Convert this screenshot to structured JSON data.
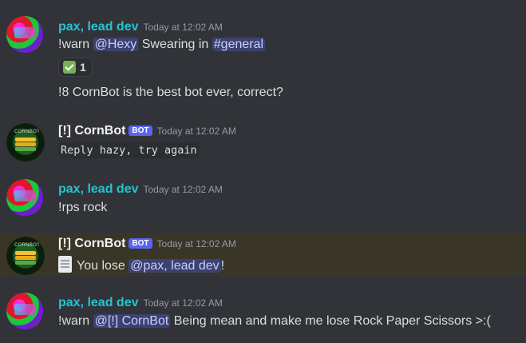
{
  "messages": [
    {
      "author": "pax, lead dev",
      "timestamp": "Today at 12:02 AM",
      "lines": {
        "warn_prefix": "!warn ",
        "mention": "@Hexy",
        "middle": " Swearing in ",
        "channel": "#general"
      },
      "reaction": {
        "emoji": "check-mark-emoji",
        "count": "1"
      },
      "followup": "!8 CornBot is the best bot ever, correct?"
    },
    {
      "author": "[!] CornBot",
      "bot_tag": "BOT",
      "timestamp": "Today at 12:02 AM",
      "code": "Reply hazy, try again",
      "avatar_text": "CORNBOT"
    },
    {
      "author": "pax, lead dev",
      "timestamp": "Today at 12:02 AM",
      "text": "!rps rock"
    },
    {
      "author": "[!] CornBot",
      "bot_tag": "BOT",
      "timestamp": "Today at 12:02 AM",
      "prefix": "You lose ",
      "mention": "@pax, lead dev",
      "suffix": "!",
      "icon": "page-icon",
      "avatar_text": "CORNBOT"
    },
    {
      "author": "pax, lead dev",
      "timestamp": "Today at 12:02 AM",
      "prefix": "!warn ",
      "mention": "@[!] CornBot",
      "suffix": " Being mean and make me lose Rock Paper Scissors >:("
    }
  ],
  "colors": {
    "background": "#313338",
    "highlight": "#3a3627",
    "username_pax": "#25c4cf",
    "mention_bg": "#3c4270",
    "bot_tag": "#5865f2"
  }
}
